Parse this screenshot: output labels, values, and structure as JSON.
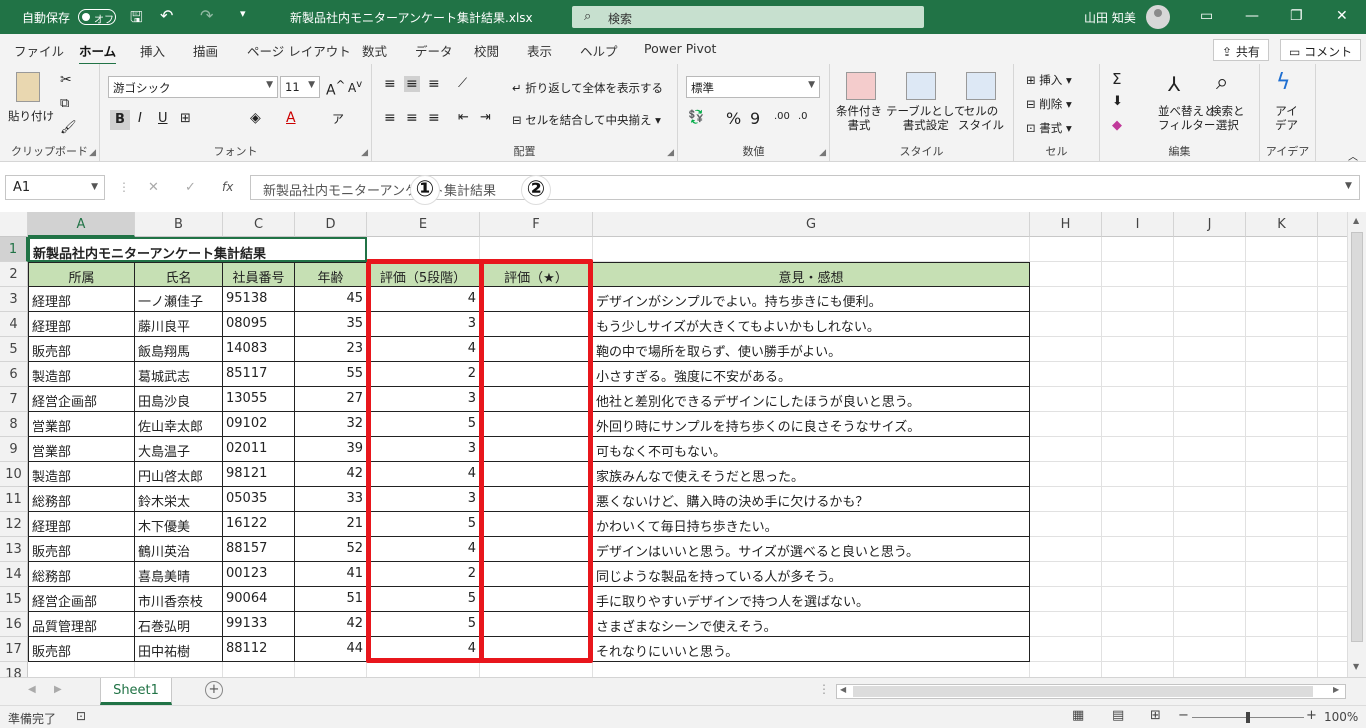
{
  "titlebar": {
    "autosave_label": "自動保存",
    "autosave_state": "オフ",
    "filename": "新製品社内モニターアンケート集計結果.xlsx",
    "search_placeholder": "検索",
    "user_name": "山田 知美"
  },
  "tabs": [
    "ファイル",
    "ホーム",
    "挿入",
    "描画",
    "ページ レイアウト",
    "数式",
    "データ",
    "校閲",
    "表示",
    "ヘルプ",
    "Power Pivot"
  ],
  "active_tab": "ホーム",
  "share_button": "共有",
  "comment_button": "コメント",
  "ribbon": {
    "clipboard": {
      "paste": "貼り付け",
      "label": "クリップボード"
    },
    "font": {
      "name": "游ゴシック",
      "size": "11",
      "label": "フォント"
    },
    "alignment": {
      "wrap": "折り返して全体を表示する",
      "merge": "セルを結合して中央揃え",
      "label": "配置"
    },
    "number": {
      "format": "標準",
      "label": "数値"
    },
    "styles": {
      "cond": "条件付き\n書式",
      "table": "テーブルとして\n書式設定",
      "cellstyle": "セルの\nスタイル",
      "label": "スタイル"
    },
    "cells": {
      "insert": "挿入",
      "delete": "削除",
      "format": "書式",
      "label": "セル"
    },
    "editing": {
      "sort": "並べ替えと\nフィルター",
      "find": "検索と\n選択",
      "label": "編集"
    },
    "ideas": {
      "btn": "アイ\nデア",
      "label": "アイデア"
    }
  },
  "formula_bar": {
    "name_box": "A1",
    "formula": "新製品社内モニターアンケート集計結果"
  },
  "columns": [
    "A",
    "B",
    "C",
    "D",
    "E",
    "F",
    "G",
    "H",
    "I",
    "J",
    "K"
  ],
  "sheet": {
    "title": "新製品社内モニターアンケート集計結果",
    "headers": [
      "所属",
      "氏名",
      "社員番号",
      "年齢",
      "評価（5段階）",
      "評価（★）",
      "意見・感想"
    ],
    "rows": [
      [
        "経理部",
        "一ノ瀬佳子",
        "95138",
        "45",
        "4",
        "",
        "デザインがシンプルでよい。持ち歩きにも便利。"
      ],
      [
        "経理部",
        "藤川良平",
        "08095",
        "35",
        "3",
        "",
        "もう少しサイズが大きくてもよいかもしれない。"
      ],
      [
        "販売部",
        "飯島翔馬",
        "14083",
        "23",
        "4",
        "",
        "鞄の中で場所を取らず、使い勝手がよい。"
      ],
      [
        "製造部",
        "葛城武志",
        "85117",
        "55",
        "2",
        "",
        "小さすぎる。強度に不安がある。"
      ],
      [
        "経営企画部",
        "田島沙良",
        "13055",
        "27",
        "3",
        "",
        "他社と差別化できるデザインにしたほうが良いと思う。"
      ],
      [
        "営業部",
        "佐山幸太郎",
        "09102",
        "32",
        "5",
        "",
        "外回り時にサンプルを持ち歩くのに良さそうなサイズ。"
      ],
      [
        "営業部",
        "大島温子",
        "02011",
        "39",
        "3",
        "",
        "可もなく不可もない。"
      ],
      [
        "製造部",
        "円山啓太郎",
        "98121",
        "42",
        "4",
        "",
        "家族みんなで使えそうだと思った。"
      ],
      [
        "総務部",
        "鈴木栄太",
        "05035",
        "33",
        "3",
        "",
        "悪くないけど、購入時の決め手に欠けるかも？"
      ],
      [
        "経理部",
        "木下優美",
        "16122",
        "21",
        "5",
        "",
        "かわいくて毎日持ち歩きたい。"
      ],
      [
        "販売部",
        "鶴川英治",
        "88157",
        "52",
        "4",
        "",
        "デザインはいいと思う。サイズが選べると良いと思う。"
      ],
      [
        "総務部",
        "喜島美晴",
        "00123",
        "41",
        "2",
        "",
        "同じような製品を持っている人が多そう。"
      ],
      [
        "経営企画部",
        "市川香奈枝",
        "90064",
        "51",
        "5",
        "",
        "手に取りやすいデザインで持つ人を選ばない。"
      ],
      [
        "品質管理部",
        "石巻弘明",
        "99133",
        "42",
        "5",
        "",
        "さまざまなシーンで使えそう。"
      ],
      [
        "販売部",
        "田中祐樹",
        "88112",
        "44",
        "4",
        "",
        "それなりにいいと思う。"
      ]
    ],
    "row_numbers": [
      "1",
      "2",
      "3",
      "4",
      "5",
      "6",
      "7",
      "8",
      "9",
      "10",
      "11",
      "12",
      "13",
      "14",
      "15",
      "16",
      "17",
      "18"
    ]
  },
  "callouts": [
    "1",
    "2"
  ],
  "sheet_tab": "Sheet1",
  "status": {
    "ready": "準備完了",
    "zoom": "100%"
  },
  "colors": {
    "excel_green": "#217346",
    "header_fill": "#c6e0b4",
    "highlight": "#e8161c"
  }
}
